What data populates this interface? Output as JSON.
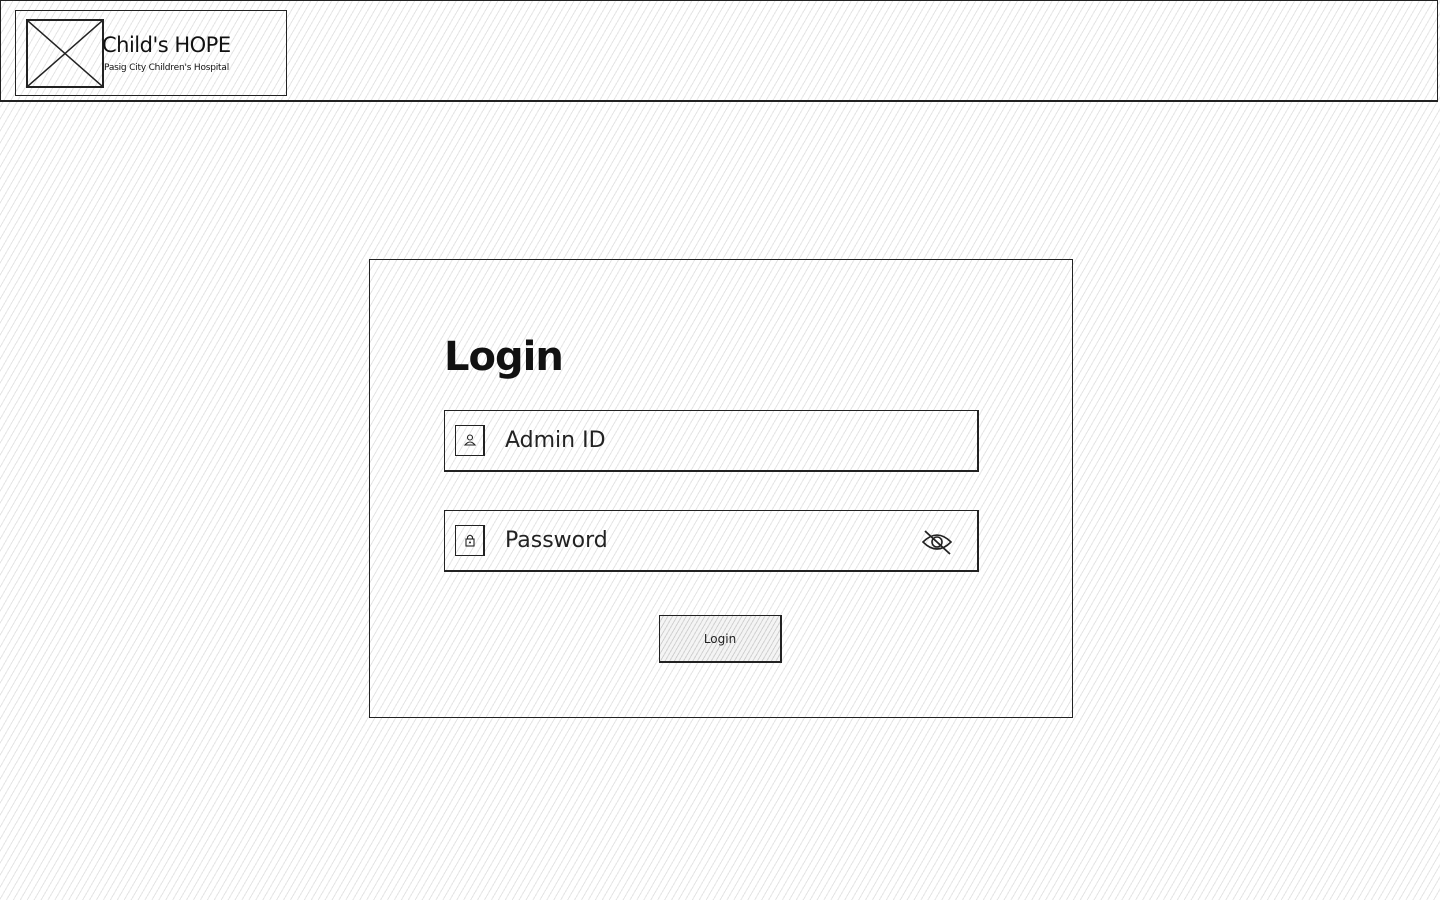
{
  "header": {
    "brand_name": "Child's HOPE",
    "brand_subtitle": "Pasig City Children's Hospital",
    "logo_icon": "image-placeholder-icon"
  },
  "login": {
    "title": "Login",
    "admin_id": {
      "placeholder": "Admin ID",
      "value": "",
      "icon": "user-icon"
    },
    "password": {
      "placeholder": "Password",
      "value": "",
      "icon": "lock-icon",
      "toggle_icon": "eye-slash-icon"
    },
    "button_label": "Login"
  }
}
